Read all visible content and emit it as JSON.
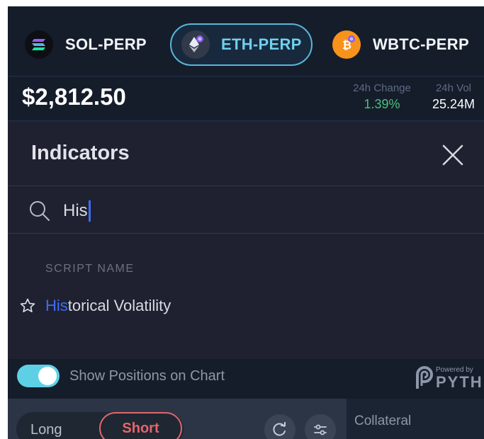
{
  "markets": [
    {
      "symbol": "SOL-PERP",
      "icon": "solana-icon",
      "active": false
    },
    {
      "symbol": "ETH-PERP",
      "icon": "ethereum-icon",
      "active": true
    },
    {
      "symbol": "WBTC-PERP",
      "icon": "bitcoin-icon",
      "active": false
    }
  ],
  "ticker": {
    "price": "$2,812.50",
    "change_label": "24h Change",
    "change_value": "1.39%",
    "volume_label": "24h Vol",
    "volume_value": "25.24M"
  },
  "indicators_dialog": {
    "title": "Indicators",
    "search_value": "His",
    "column_header": "SCRIPT NAME",
    "results": [
      {
        "match": "His",
        "rest": "torical Volatility"
      }
    ]
  },
  "bottom_bar": {
    "toggle_label": "Show Positions on Chart",
    "toggle_on": true,
    "powered_by": "Powered by",
    "oracle": "PYTH"
  },
  "order_panel": {
    "long_label": "Long",
    "short_label": "Short",
    "collateral_label": "Collateral"
  },
  "colors": {
    "accent": "#5ab6d9",
    "positive": "#48c37a",
    "short": "#e5656a",
    "search_highlight": "#3d6ef5"
  }
}
